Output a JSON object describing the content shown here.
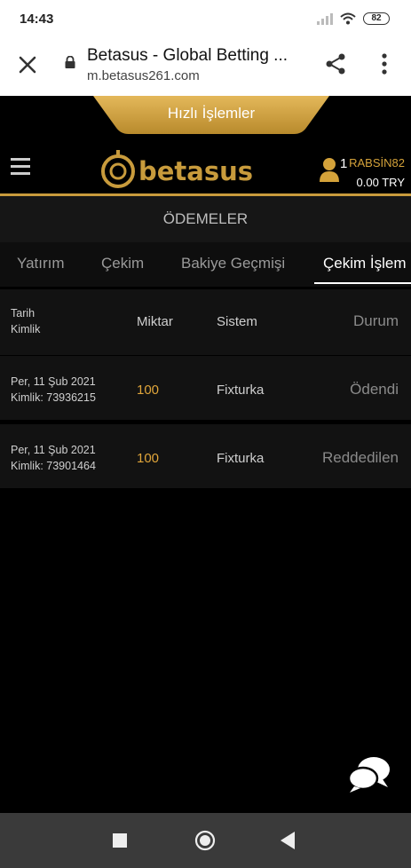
{
  "status_bar": {
    "time": "14:43",
    "battery": "82"
  },
  "browser": {
    "title": "Betasus - Global Betting ...",
    "url": "m.betasus261.com"
  },
  "quick_actions": {
    "label": "Hızlı İşlemler"
  },
  "header": {
    "brand": "betasus",
    "user_count": "1",
    "username": "RABSİN82",
    "balance": "0.00 TRY"
  },
  "section": {
    "title": "ÖDEMELER"
  },
  "tabs": [
    {
      "label": "Yatırım"
    },
    {
      "label": "Çekim"
    },
    {
      "label": "Bakiye Geçmişi"
    },
    {
      "label": "Çekim İşlem"
    }
  ],
  "table": {
    "headers": {
      "date": "Tarih",
      "id": "Kimlik",
      "amount": "Miktar",
      "system": "Sistem",
      "status": "Durum"
    },
    "rows": [
      {
        "date": "Per, 11 Şub 2021",
        "id": "Kimlik: 73936215",
        "amount": "100",
        "system": "Fixturka",
        "status": "Ödendi"
      },
      {
        "date": "Per, 11 Şub 2021",
        "id": "Kimlik: 73901464",
        "amount": "100",
        "system": "Fixturka",
        "status": "Reddedilen"
      }
    ]
  },
  "colors": {
    "accent": "#c89b3c",
    "amount": "#e0a53a",
    "background": "#000000"
  },
  "icons": {
    "close": "close-icon",
    "lock": "lock-icon",
    "share": "share-icon",
    "menu": "more-vert-icon",
    "hamburger": "hamburger-icon",
    "user": "user-icon",
    "chat": "chat-icon"
  }
}
